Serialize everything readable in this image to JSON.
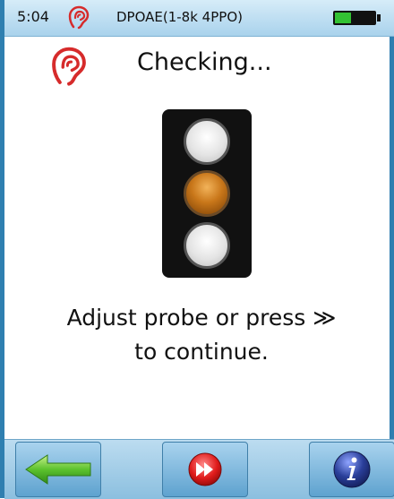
{
  "statusbar": {
    "time": "5:04",
    "mode": "DPOAE(1-8k 4PPO)",
    "ear_icon": "ear-icon",
    "battery_icon": "battery-icon",
    "battery_level": 0.4
  },
  "header": {
    "ear_icon": "ear-icon",
    "title": "Checking..."
  },
  "traffic_light": {
    "active_lamp": "middle",
    "active_color": "#c9771a"
  },
  "message": {
    "line1": "Adjust probe or press ≫",
    "line2": "to continue."
  },
  "toolbar": {
    "back_icon": "back-arrow-icon",
    "forward_icon": "fast-forward-icon",
    "info_icon": "info-icon"
  },
  "colors": {
    "accent": "#2f7fb0",
    "ear_red": "#d62b2b",
    "arrow_green": "#4ab02a",
    "info_blue": "#2a3f9a"
  }
}
